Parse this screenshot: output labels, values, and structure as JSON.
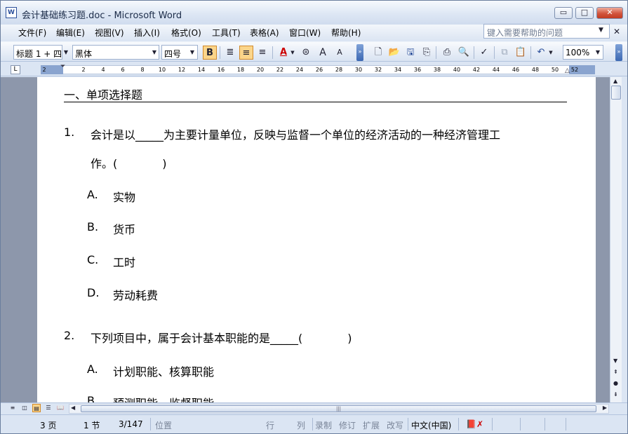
{
  "window": {
    "title": "会计基础练习题.doc - Microsoft Word",
    "min": "▭",
    "max": "□",
    "close": "✕"
  },
  "menubar": {
    "items": [
      "文件(F)",
      "编辑(E)",
      "视图(V)",
      "插入(I)",
      "格式(O)",
      "工具(T)",
      "表格(A)",
      "窗口(W)",
      "帮助(H)"
    ],
    "help_placeholder": "键入需要帮助的问题"
  },
  "toolbar": {
    "style": "标题 1 + 四",
    "font": "黑体",
    "size": "四号",
    "bold": "B",
    "zoom": "100%",
    "font_color": "A",
    "grow_font": "A",
    "shrink_font": "A"
  },
  "ruler": {
    "tab_selector": "L",
    "ticks": [
      "2",
      "2",
      "4",
      "6",
      "8",
      "10",
      "12",
      "14",
      "16",
      "18",
      "20",
      "22",
      "24",
      "26",
      "28",
      "30",
      "32",
      "34",
      "36",
      "38",
      "40",
      "42",
      "44",
      "46",
      "48",
      "50",
      "52"
    ]
  },
  "document": {
    "heading": "一、单项选择题",
    "q1": {
      "num": "1.",
      "line1": "会计是以_____为主要计量单位，反映与监督一个单位的经济活动的一种经济管理工",
      "line2": "作。(　　　　)"
    },
    "q1_options": [
      {
        "label": "A.",
        "text": "实物"
      },
      {
        "label": "B.",
        "text": "货币"
      },
      {
        "label": "C.",
        "text": "工时"
      },
      {
        "label": "D.",
        "text": "劳动耗费"
      }
    ],
    "q2": {
      "num": "2.",
      "line1": "下列项目中，属于会计基本职能的是_____(　　　　)"
    },
    "q2_options": [
      {
        "label": "A.",
        "text": "计划职能、核算职能"
      },
      {
        "label": "B.",
        "text": "预测职能、监督职能"
      }
    ]
  },
  "statusbar": {
    "page": "3 页",
    "section": "1 节",
    "page_of": "3/147",
    "position": "位置",
    "line": "行",
    "col": "列",
    "rec": "录制",
    "trk": "修订",
    "ext": "扩展",
    "ovr": "改写",
    "lang": "中文(中国)"
  }
}
